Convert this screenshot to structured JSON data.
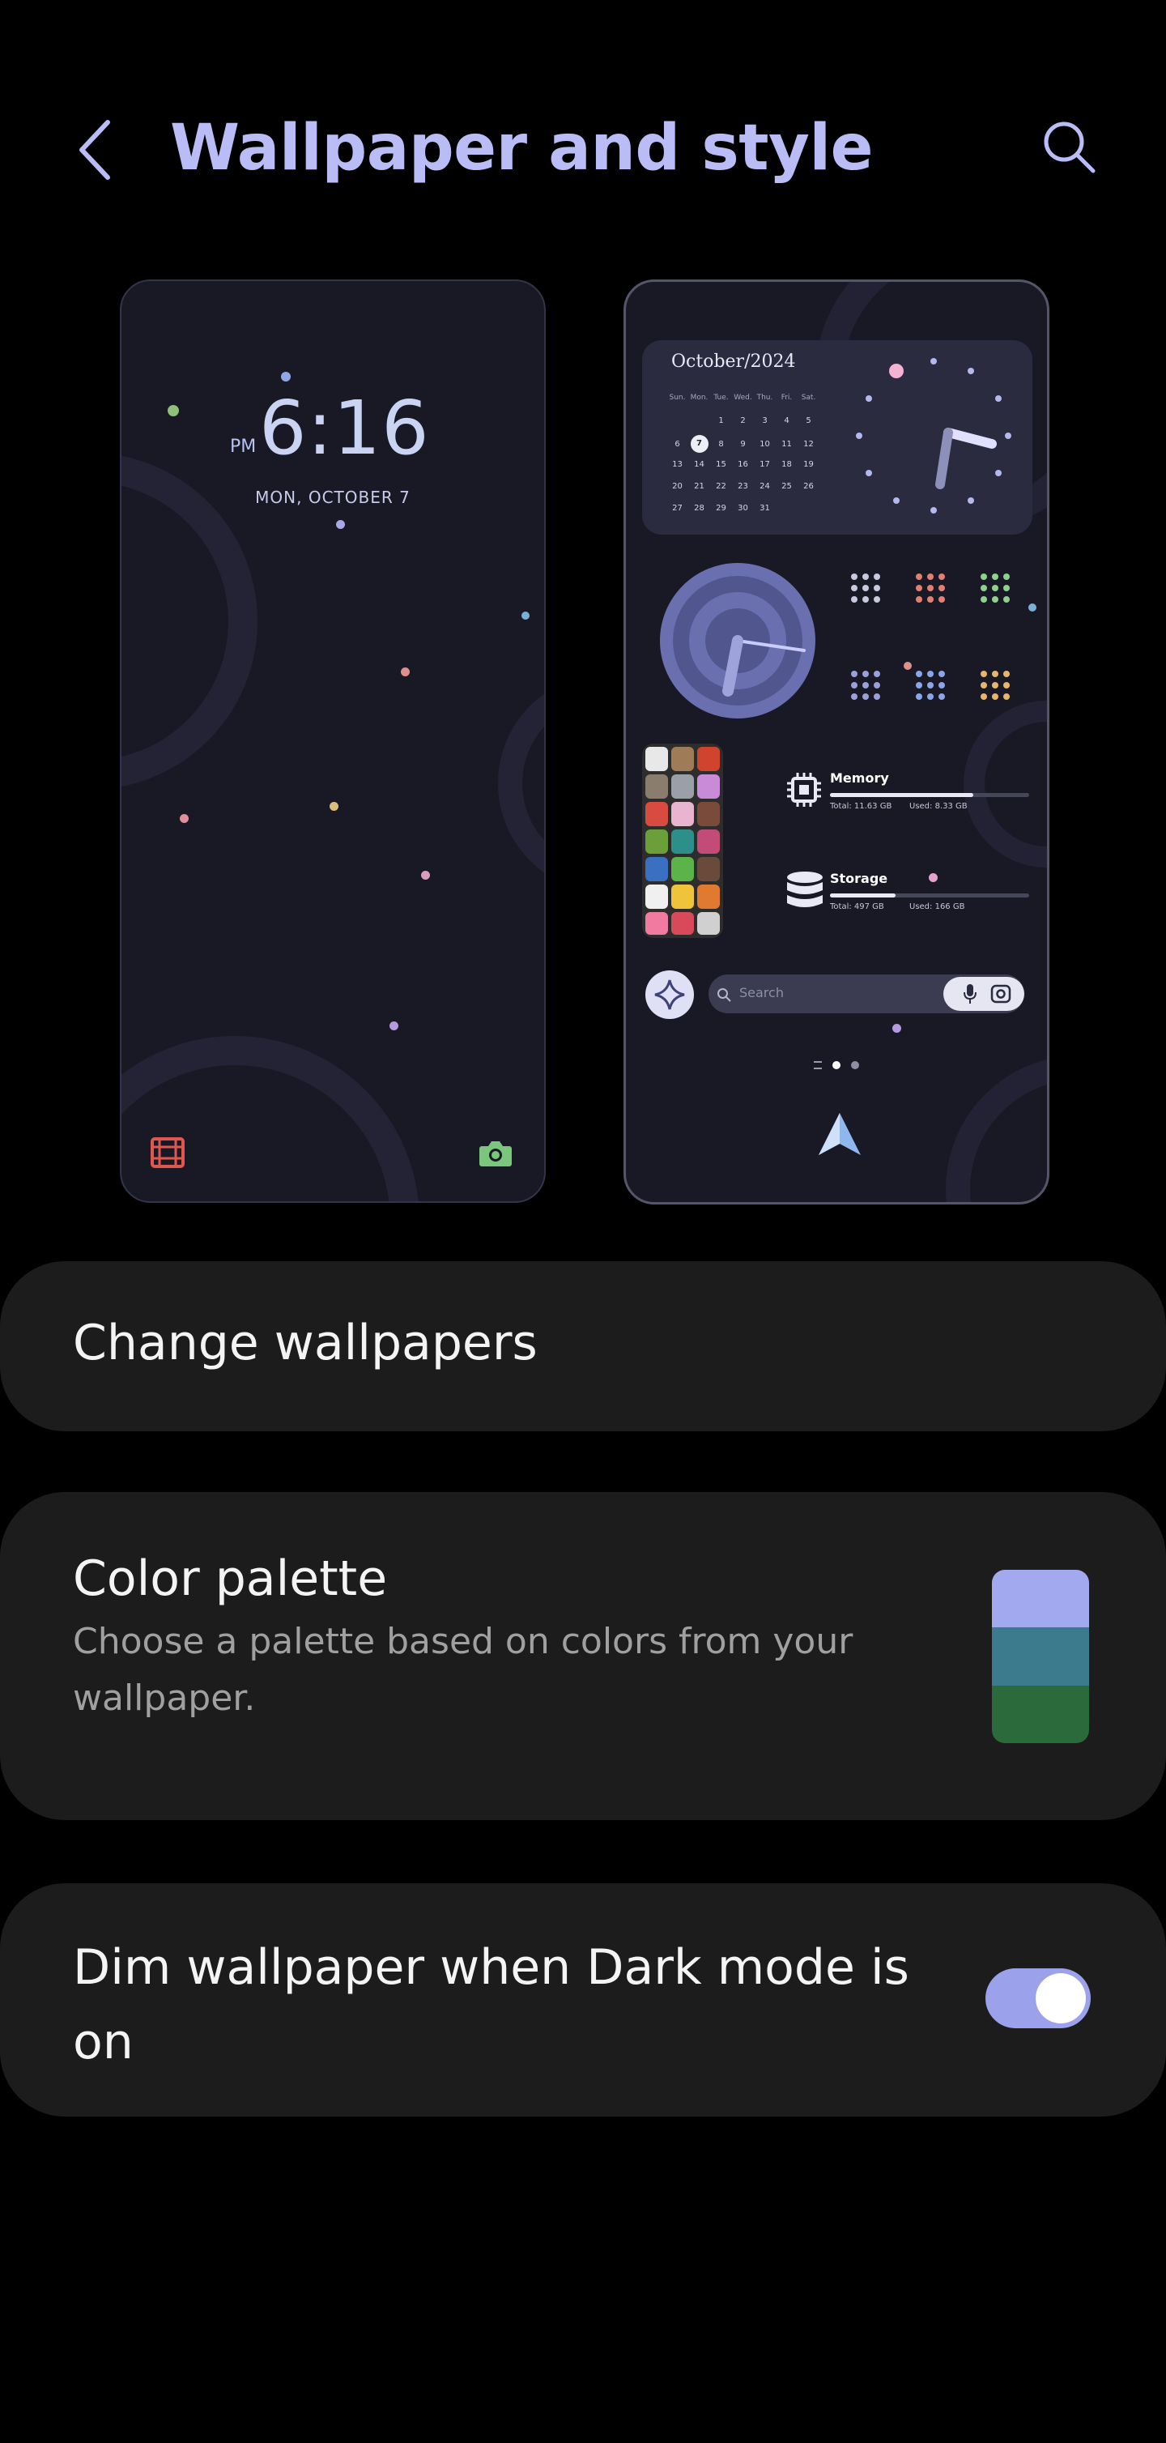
{
  "header": {
    "title": "Wallpaper and style",
    "back_icon": "chevron-left-icon",
    "search_icon": "search-icon"
  },
  "lock_screen": {
    "time": "6:16",
    "ampm": "PM",
    "date": "MON, OCTOBER 7",
    "shortcut_left_icon": "film-icon",
    "shortcut_right_icon": "camera-icon"
  },
  "home_screen": {
    "calendar": {
      "title": "October/2024",
      "weekdays": [
        "Sun.",
        "Mon.",
        "Tue.",
        "Wed.",
        "Thu.",
        "Fri.",
        "Sat."
      ],
      "weeks": [
        [
          "",
          "",
          "1",
          "2",
          "3",
          "4",
          "5"
        ],
        [
          "6",
          "7",
          "8",
          "9",
          "10",
          "11",
          "12"
        ],
        [
          "13",
          "14",
          "15",
          "16",
          "17",
          "18",
          "19"
        ],
        [
          "20",
          "21",
          "22",
          "23",
          "24",
          "25",
          "26"
        ],
        [
          "27",
          "28",
          "29",
          "30",
          "31",
          "",
          ""
        ]
      ],
      "today": "7"
    },
    "memory": {
      "label": "Memory",
      "total": "Total: 11.63 GB",
      "used": "Used: 8.33 GB",
      "used_fraction": 0.72
    },
    "storage": {
      "label": "Storage",
      "total": "Total: 497 GB",
      "used": "Used: 166 GB",
      "used_fraction": 0.33
    },
    "search": {
      "placeholder": "Search",
      "mic_icon": "mic-icon",
      "lens_icon": "lens-icon",
      "assistant_icon": "sparkle-icon"
    },
    "page_indicator": {
      "pages": 3,
      "current": 2
    },
    "dock_icon": "navigation-arrow-icon"
  },
  "settings": {
    "change_wallpapers": "Change wallpapers",
    "color_palette": {
      "title": "Color palette",
      "subtitle": "Choose a palette based on colors from your wallpaper.",
      "colors": [
        "#a3a9ee",
        "#3c7a8d",
        "#2b6a3a"
      ]
    },
    "dim_wallpaper": {
      "title": "Dim wallpaper when Dark mode is on",
      "enabled": true
    }
  },
  "colors": {
    "accent": "#b9bcf5",
    "card_background": "#1c1c1c",
    "toggle_on": "#9ca1ec"
  }
}
